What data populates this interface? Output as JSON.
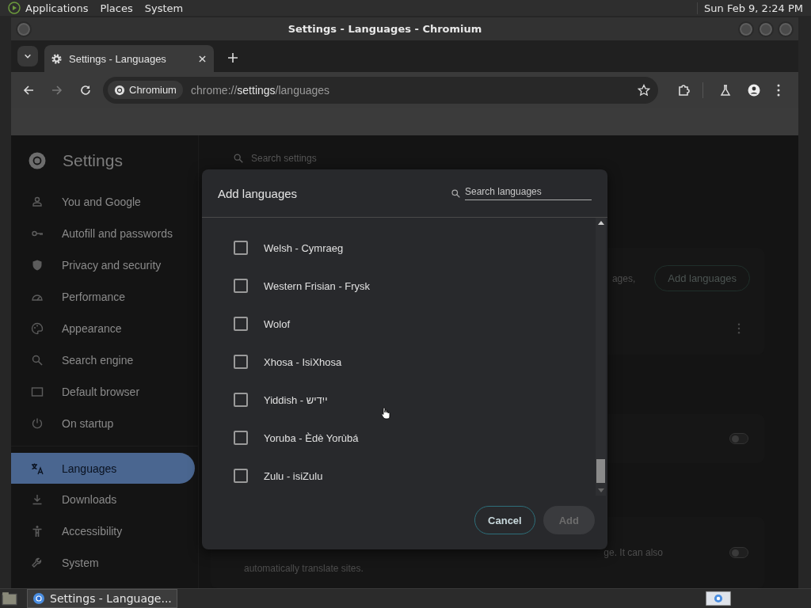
{
  "top_panel": {
    "menus": [
      "Applications",
      "Places",
      "System"
    ],
    "clock": "Sun Feb  9,  2:24 PM"
  },
  "window": {
    "title": "Settings - Languages - Chromium"
  },
  "tabs": [
    {
      "label": "Settings - Languages",
      "selected": true
    }
  ],
  "toolbar": {
    "site_chip": "Chromium",
    "url": {
      "scheme": "chrome://",
      "host": "settings",
      "path": "/languages"
    }
  },
  "settings": {
    "title": "Settings",
    "search_placeholder": "Search settings",
    "sidebar": {
      "items": [
        {
          "label": "You and Google",
          "selected": false
        },
        {
          "label": "Autofill and passwords",
          "selected": false
        },
        {
          "label": "Privacy and security",
          "selected": false
        },
        {
          "label": "Performance",
          "selected": false
        },
        {
          "label": "Appearance",
          "selected": false
        },
        {
          "label": "Search engine",
          "selected": false
        },
        {
          "label": "Default browser",
          "selected": false
        },
        {
          "label": "On startup",
          "selected": false
        },
        {
          "label": "Languages",
          "selected": true
        },
        {
          "label": "Downloads",
          "selected": false
        },
        {
          "label": "Accessibility",
          "selected": false
        },
        {
          "label": "System",
          "selected": false
        }
      ]
    },
    "cards": [
      {
        "kind": "languages",
        "text": "ages,",
        "button": "Add languages"
      },
      {
        "kind": "toggle",
        "on": false
      },
      {
        "kind": "toggle_text",
        "line_1": "ge. It can also",
        "line_2": "automatically translate sites.",
        "on": false
      }
    ]
  },
  "dialog": {
    "title": "Add languages",
    "search_placeholder": "Search languages",
    "languages": [
      {
        "label": "Welsh - Cymraeg",
        "checked": false
      },
      {
        "label": "Western Frisian - Frysk",
        "checked": false
      },
      {
        "label": "Wolof",
        "checked": false
      },
      {
        "label": "Xhosa - IsiXhosa",
        "checked": false
      },
      {
        "label": "Yiddish - ייִדיש",
        "checked": false
      },
      {
        "label": "Yoruba - Èdè Yorùbá",
        "checked": false
      },
      {
        "label": "Zulu - isiZulu",
        "checked": false
      }
    ],
    "buttons": [
      {
        "label": "Cancel",
        "kind": "secondary",
        "disabled": false
      },
      {
        "label": "Add",
        "kind": "primary",
        "disabled": true
      }
    ]
  },
  "taskbar": {
    "tasks": [
      {
        "label": "Settings - Language...",
        "selected": false
      }
    ]
  }
}
